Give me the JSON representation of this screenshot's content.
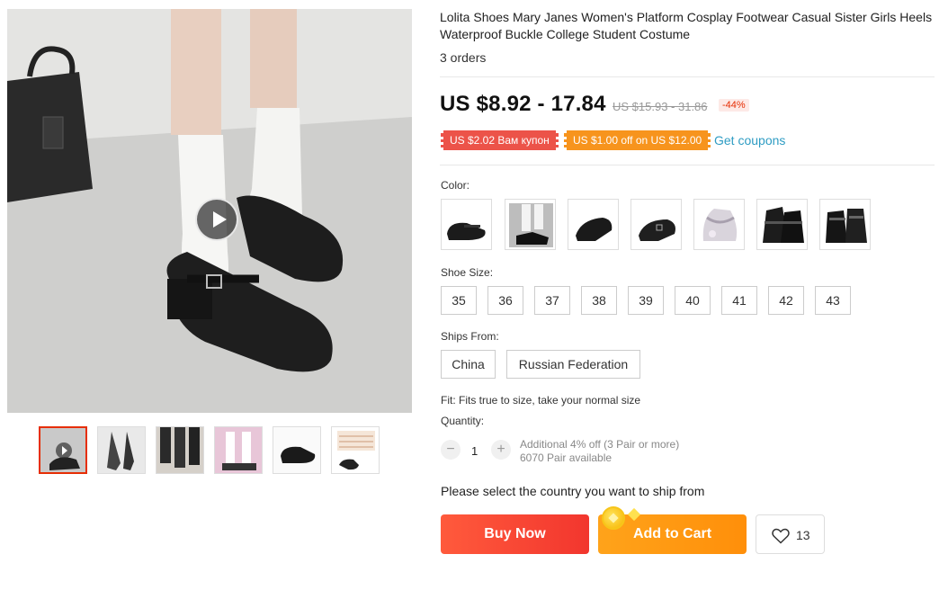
{
  "gallery": {
    "main_image": "product-photo-shoes-on-feet",
    "play_icon": "play-icon",
    "thumbnails": [
      {
        "name": "thumb-video",
        "active": true
      },
      {
        "name": "thumb-legs"
      },
      {
        "name": "thumb-group"
      },
      {
        "name": "thumb-pink-pair"
      },
      {
        "name": "thumb-single-shoe"
      },
      {
        "name": "thumb-size-chart"
      }
    ]
  },
  "product": {
    "title": "Lolita Shoes Mary Janes Women's Platform Cosplay Footwear Casual Sister Girls Heels Waterproof Buckle College Student Costume",
    "orders": "3 orders",
    "price": "US $8.92 - 17.84",
    "original_price": "US $15.93 - 31.86",
    "discount": "-44%",
    "coupons": [
      "US $2.02 Вам купон",
      "US $1.00 off on US $12.00"
    ],
    "get_coupons": "Get coupons"
  },
  "options": {
    "color_label": "Color:",
    "colors": [
      "black-mary-jane",
      "white-socks-model",
      "black-single",
      "black-buckle",
      "white-lace",
      "black-double-strap",
      "black-patent"
    ],
    "size_label": "Shoe Size:",
    "sizes": [
      "35",
      "36",
      "37",
      "38",
      "39",
      "40",
      "41",
      "42",
      "43"
    ],
    "ships_label": "Ships From:",
    "ships": [
      "China",
      "Russian Federation"
    ],
    "fit": "Fit: Fits true to size, take your normal size",
    "quantity_label": "Quantity:",
    "quantity": "1",
    "qty_minus": "−",
    "qty_plus": "+",
    "qty_note_1": "Additional 4% off (3 Pair or more)",
    "qty_note_2": "6070 Pair available"
  },
  "actions": {
    "ship_note": "Please select the country you want to ship from",
    "buy_now": "Buy Now",
    "add_to_cart": "Add to Cart",
    "wishlist_count": "13"
  },
  "colors": {
    "accent_red": "#f2362e",
    "accent_orange": "#ff8f0a",
    "link_blue": "#2e9cc3",
    "coupon_red": "#ec5349",
    "coupon_orange": "#f7941d"
  }
}
